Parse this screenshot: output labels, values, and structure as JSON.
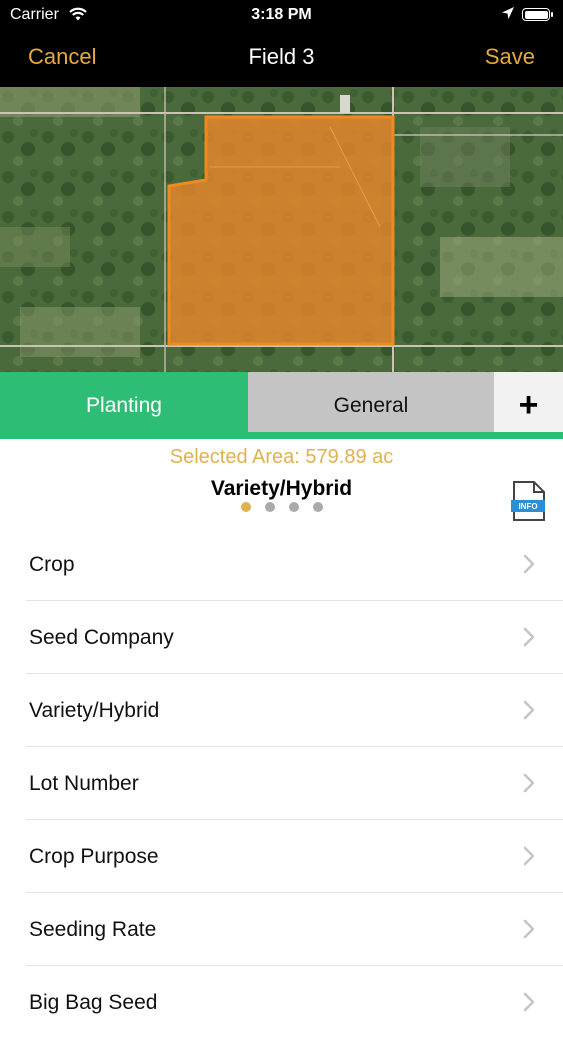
{
  "status_bar": {
    "carrier": "Carrier",
    "time": "3:18 PM",
    "icons": [
      "wifi-icon",
      "location-arrow-icon",
      "battery-icon"
    ]
  },
  "nav": {
    "cancel_label": "Cancel",
    "title": "Field 3",
    "save_label": "Save"
  },
  "colors": {
    "accent": "#e8a940",
    "green": "#2ebd75",
    "area_text": "#e0b150",
    "field_fill": "#e8862a"
  },
  "tabs": [
    {
      "label": "Planting",
      "selected": true
    },
    {
      "label": "General",
      "selected": false
    },
    {
      "label": "+"
    }
  ],
  "selected_area": "Selected Area: 579.89 ac",
  "section_title": "Variety/Hybrid",
  "pager": {
    "count": 4,
    "active": 0
  },
  "info_icon": {
    "name": "info-document-icon",
    "text": "INFO"
  },
  "list": [
    {
      "label": "Crop"
    },
    {
      "label": "Seed Company"
    },
    {
      "label": "Variety/Hybrid"
    },
    {
      "label": "Lot Number"
    },
    {
      "label": "Crop Purpose"
    },
    {
      "label": "Seeding Rate"
    },
    {
      "label": "Big Bag Seed"
    }
  ]
}
